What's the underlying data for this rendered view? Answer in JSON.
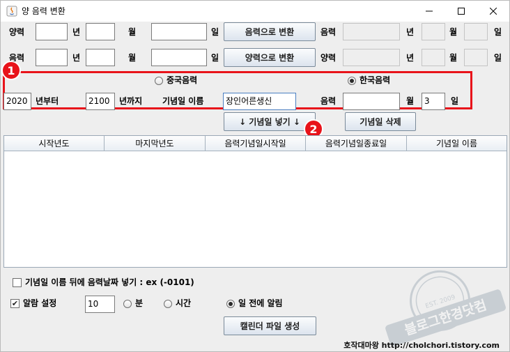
{
  "window": {
    "title": "양 음력 변환"
  },
  "row1": {
    "label": "양력",
    "year_unit": "년",
    "month_unit": "월",
    "day_unit": "일",
    "convert_button": "음력으로 변환",
    "result_label": "음력",
    "result_year_unit": "년",
    "result_month_unit": "월",
    "result_day_unit": "일"
  },
  "row2": {
    "label": "음력",
    "year_unit": "년",
    "month_unit": "월",
    "day_unit": "일",
    "convert_button": "양력으로 변환",
    "result_label": "양력",
    "result_year_unit": "년",
    "result_month_unit": "월",
    "result_day_unit": "일"
  },
  "badges": {
    "one": "1",
    "two": "2"
  },
  "lunar_type": {
    "chinese": "중국음력",
    "korean": "한국음력",
    "selected": "korean"
  },
  "anniversary": {
    "start_year": "2020",
    "from_label": "년부터",
    "end_year": "2100",
    "to_label": "년까지",
    "name_label": "기념일 이름",
    "name_value": "장인어른생신",
    "lunar_label": "음력",
    "month_value": "",
    "month_unit": "월",
    "day_value": "3",
    "day_unit": "일"
  },
  "buttons": {
    "add": "↓ 기념일 넣기 ↓",
    "delete": "기념일 삭제",
    "create_file": "캘린더 파일 생성"
  },
  "table": {
    "columns": [
      "시작년도",
      "마지막년도",
      "음력기념일시작일",
      "음력기념일종료일",
      "기념일 이름"
    ]
  },
  "options": {
    "append_lunar_label": "기념일 이름 뒤에 음력날짜 넣기 : ex (-0101)",
    "append_lunar_checked": false,
    "alarm_label": "알람 설정",
    "alarm_checked": true,
    "alarm_value": "10",
    "unit_minute": "분",
    "unit_hour": "시간",
    "unit_day_before": "일 전에 알림",
    "selected_unit": "day_before"
  },
  "credit": "호작대마왕 http://cholchori.tistory.com",
  "watermark": {
    "text1": "블로그한경닷컴",
    "text2": "EST. 2009"
  },
  "colors": {
    "highlight": "#e8131a",
    "button_gradient_top": "#fbfcfd",
    "button_gradient_bottom": "#dce4ee"
  }
}
